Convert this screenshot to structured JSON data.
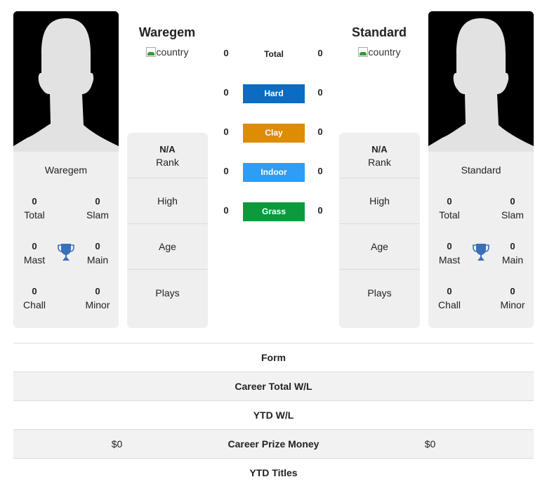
{
  "left_player": {
    "name": "Waregem",
    "header_name": "Waregem",
    "flag_alt": "country",
    "stats": {
      "total": {
        "value": "0",
        "label": "Total"
      },
      "slam": {
        "value": "0",
        "label": "Slam"
      },
      "mast": {
        "value": "0",
        "label": "Mast"
      },
      "main": {
        "value": "0",
        "label": "Main"
      },
      "chall": {
        "value": "0",
        "label": "Chall"
      },
      "minor": {
        "value": "0",
        "label": "Minor"
      }
    },
    "info": {
      "rank_value": "N/A",
      "rank_label": "Rank",
      "high_label": "High",
      "age_label": "Age",
      "plays_label": "Plays"
    }
  },
  "right_player": {
    "name": "Standard",
    "header_name": "Standard",
    "flag_alt": "country",
    "stats": {
      "total": {
        "value": "0",
        "label": "Total"
      },
      "slam": {
        "value": "0",
        "label": "Slam"
      },
      "mast": {
        "value": "0",
        "label": "Mast"
      },
      "main": {
        "value": "0",
        "label": "Main"
      },
      "chall": {
        "value": "0",
        "label": "Chall"
      },
      "minor": {
        "value": "0",
        "label": "Minor"
      }
    },
    "info": {
      "rank_value": "N/A",
      "rank_label": "Rank",
      "high_label": "High",
      "age_label": "Age",
      "plays_label": "Plays"
    }
  },
  "surfaces": [
    {
      "label": "Total",
      "left": "0",
      "right": "0",
      "color": ""
    },
    {
      "label": "Hard",
      "left": "0",
      "right": "0",
      "color": "#0b6cc3"
    },
    {
      "label": "Clay",
      "left": "0",
      "right": "0",
      "color": "#de8c04"
    },
    {
      "label": "Indoor",
      "left": "0",
      "right": "0",
      "color": "#2e9df5"
    },
    {
      "label": "Grass",
      "left": "0",
      "right": "0",
      "color": "#0c9a3c"
    }
  ],
  "comparison": [
    {
      "label": "Form",
      "left": "",
      "right": ""
    },
    {
      "label": "Career Total W/L",
      "left": "",
      "right": ""
    },
    {
      "label": "YTD W/L",
      "left": "",
      "right": ""
    },
    {
      "label": "Career Prize Money",
      "left": "$0",
      "right": "$0"
    },
    {
      "label": "YTD Titles",
      "left": "",
      "right": ""
    }
  ],
  "colors": {
    "trophy": "#3b6fba",
    "card_bg": "#efefef"
  }
}
